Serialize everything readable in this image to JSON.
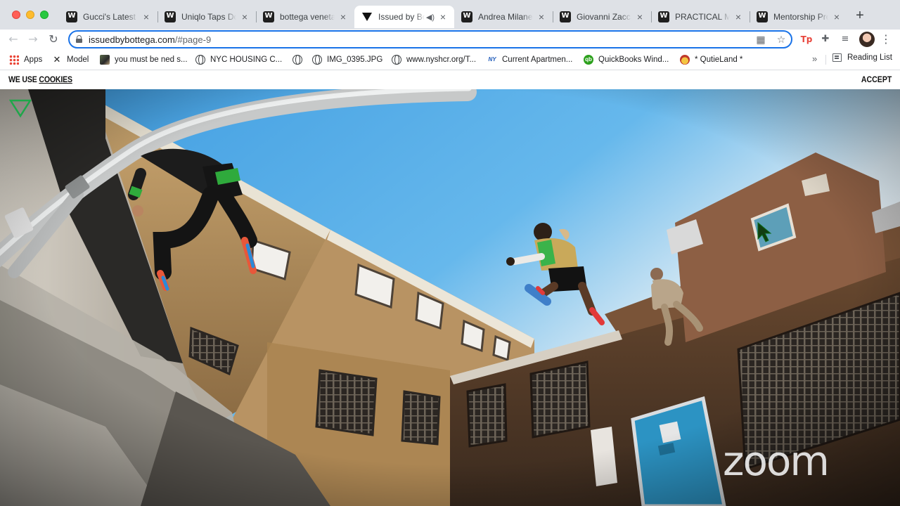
{
  "browser": {
    "tabs": [
      {
        "title": "Gucci's Latest C",
        "active": false
      },
      {
        "title": "Uniqlo Taps Dor",
        "active": false
      },
      {
        "title": "bottega veneta",
        "active": false
      },
      {
        "title": "Issued by Bo",
        "active": true,
        "audio": "◀)"
      },
      {
        "title": "Andrea Milanes",
        "active": false
      },
      {
        "title": "Giovanni Zaccar",
        "active": false
      },
      {
        "title": "PRACTICAL MIN",
        "active": false
      },
      {
        "title": "Mentorship Prog",
        "active": false
      }
    ],
    "new_tab": "+",
    "close_glyph": "×",
    "nav": {
      "back": "←",
      "forward": "→",
      "reload": "↻"
    },
    "url": {
      "host": "issuedbybottega.com",
      "path": "/#page-9"
    },
    "menu": "⋮"
  },
  "bookmarks": {
    "items": [
      {
        "label": "Apps",
        "icon": "apps-grid-icon"
      },
      {
        "label": "Model",
        "icon": "x-icon"
      },
      {
        "label": "you must be ned s...",
        "icon": "thumbnail-icon"
      },
      {
        "label": "NYC HOUSING C...",
        "icon": "globe-icon"
      },
      {
        "label": "",
        "icon": "globe-icon"
      },
      {
        "label": "IMG_0395.JPG",
        "icon": "globe-icon"
      },
      {
        "label": "www.nyshcr.org/T...",
        "icon": "globe-icon"
      },
      {
        "label": "Current Apartmen...",
        "icon": "ny-logo-icon",
        "glyph": "NY"
      },
      {
        "label": "QuickBooks Wind...",
        "icon": "quickbooks-icon",
        "glyph": "qb"
      },
      {
        "label": "* QutieLand *",
        "icon": "qutieland-icon"
      }
    ],
    "more": "»",
    "reading_list": "Reading List"
  },
  "page": {
    "cookie_prefix": "WE USE ",
    "cookie_link": "COOKIES",
    "accept": "ACCEPT",
    "watermark": "zoom"
  },
  "colors": {
    "omnibox_focus": "#1a73e8",
    "bv_green": "#1fa64a",
    "sky": "#4aa3e0"
  }
}
